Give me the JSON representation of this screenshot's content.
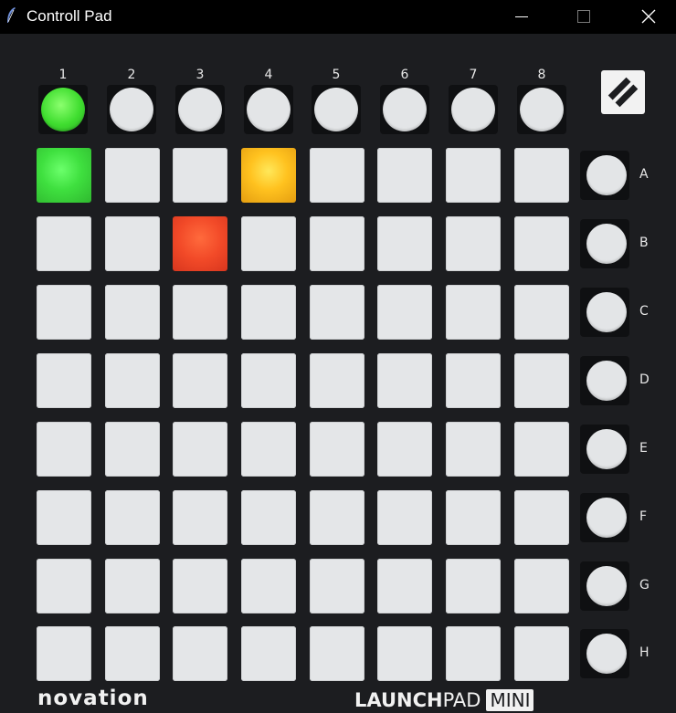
{
  "window": {
    "title": "Controll Pad",
    "controls": [
      "minimize",
      "maximize",
      "close"
    ]
  },
  "top_buttons": [
    {
      "label": "1",
      "color": "green"
    },
    {
      "label": "2",
      "color": "off"
    },
    {
      "label": "3",
      "color": "off"
    },
    {
      "label": "4",
      "color": "off"
    },
    {
      "label": "5",
      "color": "off"
    },
    {
      "label": "6",
      "color": "off"
    },
    {
      "label": "7",
      "color": "off"
    },
    {
      "label": "8",
      "color": "off"
    }
  ],
  "row_buttons": [
    "A",
    "B",
    "C",
    "D",
    "E",
    "F",
    "G",
    "H"
  ],
  "grid": [
    [
      "green",
      "off",
      "off",
      "amber",
      "off",
      "off",
      "off",
      "off"
    ],
    [
      "off",
      "off",
      "red",
      "off",
      "off",
      "off",
      "off",
      "off"
    ],
    [
      "off",
      "off",
      "off",
      "off",
      "off",
      "off",
      "off",
      "off"
    ],
    [
      "off",
      "off",
      "off",
      "off",
      "off",
      "off",
      "off",
      "off"
    ],
    [
      "off",
      "off",
      "off",
      "off",
      "off",
      "off",
      "off",
      "off"
    ],
    [
      "off",
      "off",
      "off",
      "off",
      "off",
      "off",
      "off",
      "off"
    ],
    [
      "off",
      "off",
      "off",
      "off",
      "off",
      "off",
      "off",
      "off"
    ],
    [
      "off",
      "off",
      "off",
      "off",
      "off",
      "off",
      "off",
      "off"
    ]
  ],
  "colors": {
    "green": "#3fe03f",
    "amber": "#ffc21f",
    "red": "#f24a28",
    "off": "#e4e6e8"
  },
  "branding": {
    "maker": "novation",
    "product_bold": "LAUNCH",
    "product_light": "PAD",
    "product_badge": "MINI"
  }
}
